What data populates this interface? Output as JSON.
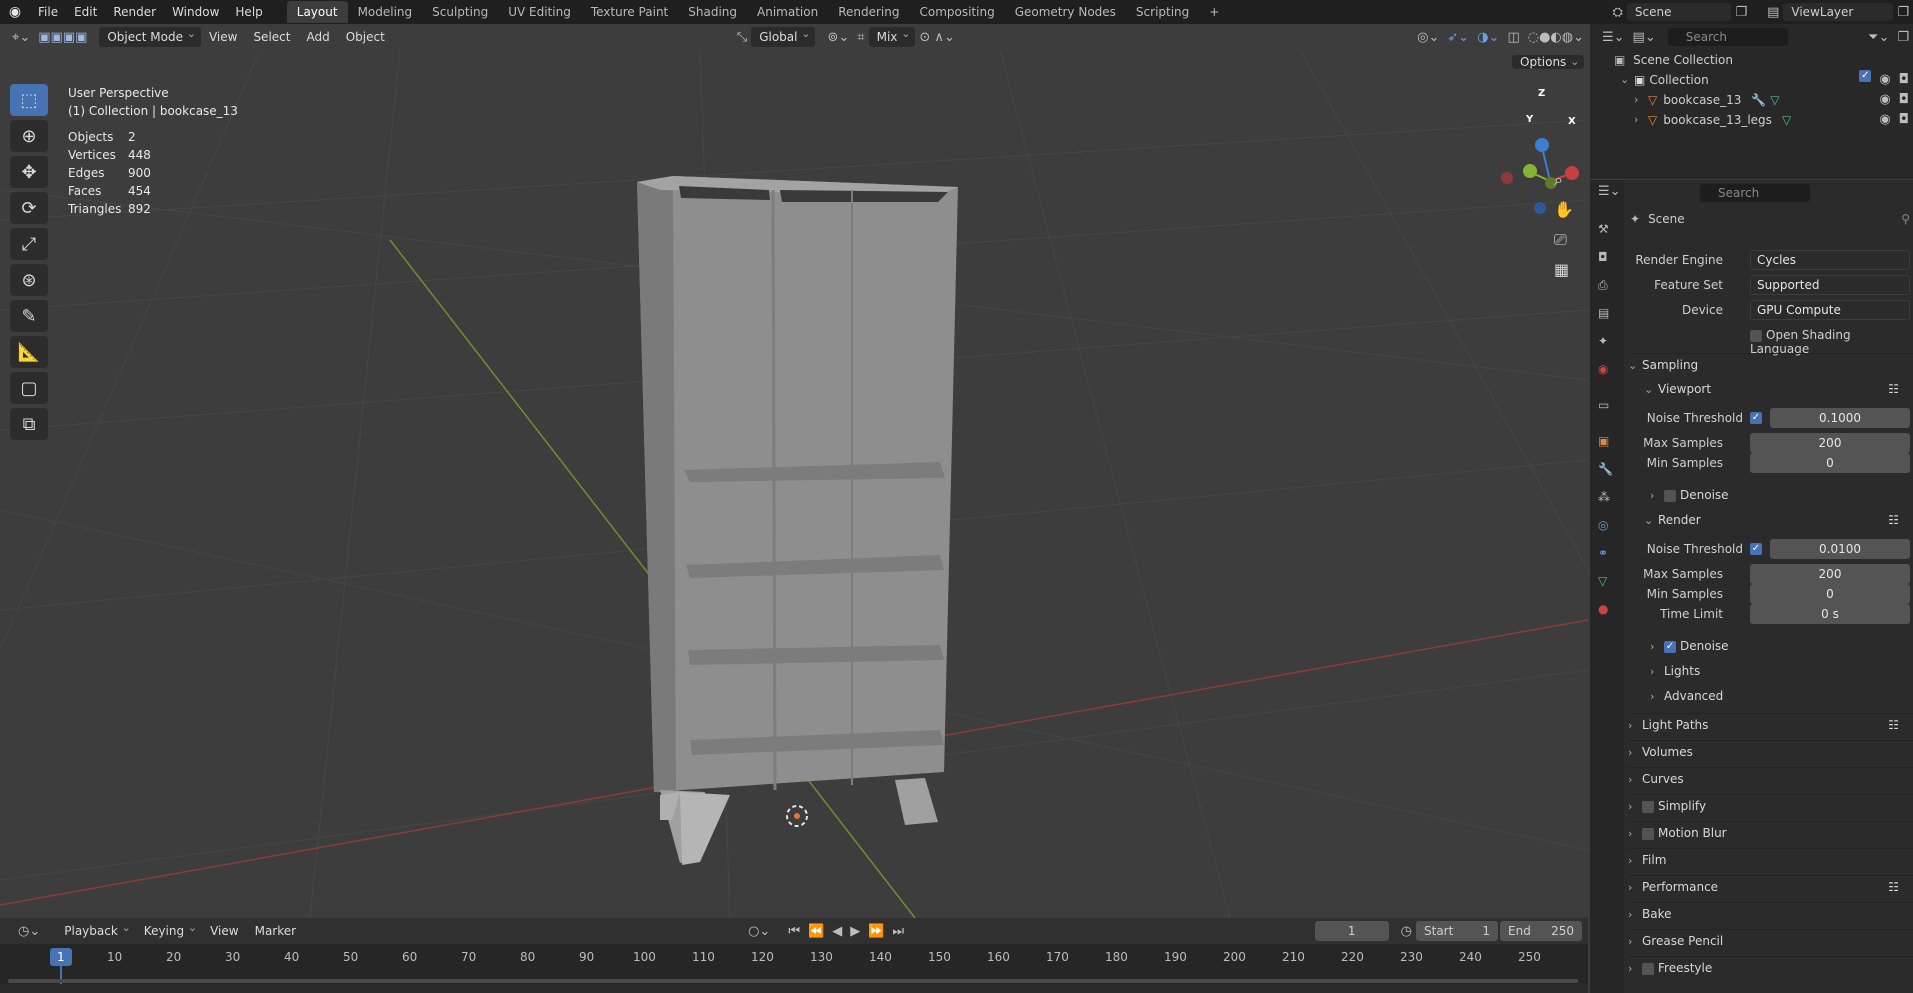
{
  "topbar": {
    "menus": [
      "File",
      "Edit",
      "Render",
      "Window",
      "Help"
    ],
    "workspaces": [
      "Layout",
      "Modeling",
      "Sculpting",
      "UV Editing",
      "Texture Paint",
      "Shading",
      "Animation",
      "Rendering",
      "Compositing",
      "Geometry Nodes",
      "Scripting"
    ],
    "active_workspace": "Layout",
    "add_tab": "+",
    "scene": "Scene",
    "view_layer": "ViewLayer"
  },
  "viewport_header": {
    "mode": "Object Mode",
    "menus": [
      "View",
      "Select",
      "Add",
      "Object"
    ],
    "orientation": "Global",
    "pivot": "Mix",
    "options": "Options"
  },
  "overlay": {
    "perspective": "User Perspective",
    "collection": "(1) Collection | bookcase_13",
    "stats": [
      {
        "label": "Objects",
        "value": "2"
      },
      {
        "label": "Vertices",
        "value": "448"
      },
      {
        "label": "Edges",
        "value": "900"
      },
      {
        "label": "Faces",
        "value": "454"
      },
      {
        "label": "Triangles",
        "value": "892"
      }
    ]
  },
  "gizmo": {
    "x": "X",
    "y": "Y",
    "z": "Z"
  },
  "outliner": {
    "search_placeholder": "Search",
    "scene_collection": "Scene Collection",
    "collection": "Collection",
    "objects": [
      "bookcase_13",
      "bookcase_13_legs"
    ]
  },
  "properties": {
    "search_placeholder": "Search",
    "context": "Scene",
    "render_engine_label": "Render Engine",
    "render_engine": "Cycles",
    "feature_set_label": "Feature Set",
    "feature_set": "Supported",
    "device_label": "Device",
    "device": "GPU Compute",
    "osl": "Open Shading Language",
    "sampling": "Sampling",
    "viewport": "Viewport",
    "noise_threshold_label": "Noise Threshold",
    "vp_noise_threshold": "0.1000",
    "max_samples_label": "Max Samples",
    "vp_max_samples": "200",
    "min_samples_label": "Min Samples",
    "vp_min_samples": "0",
    "denoise": "Denoise",
    "render": "Render",
    "r_noise_threshold": "0.0100",
    "r_max_samples": "200",
    "r_min_samples": "0",
    "time_limit_label": "Time Limit",
    "r_time_limit": "0 s",
    "lights": "Lights",
    "advanced": "Advanced",
    "panels": [
      "Light Paths",
      "Volumes",
      "Curves",
      "Simplify",
      "Motion Blur",
      "Film",
      "Performance",
      "Bake",
      "Grease Pencil",
      "Freestyle"
    ]
  },
  "timeline": {
    "menus": [
      "Playback",
      "Keying",
      "View",
      "Marker"
    ],
    "current_frame": "1",
    "start_label": "Start",
    "start": "1",
    "end_label": "End",
    "end": "250",
    "ticks": [
      "1",
      "10",
      "20",
      "30",
      "40",
      "50",
      "60",
      "70",
      "80",
      "90",
      "100",
      "110",
      "120",
      "130",
      "140",
      "150",
      "160",
      "170",
      "180",
      "190",
      "200",
      "210",
      "220",
      "230",
      "240",
      "250"
    ]
  },
  "colors": {
    "accent": "#4772b3",
    "x_axis": "#c4413f",
    "y_axis": "#86b336",
    "z_axis": "#3d7ed3"
  }
}
